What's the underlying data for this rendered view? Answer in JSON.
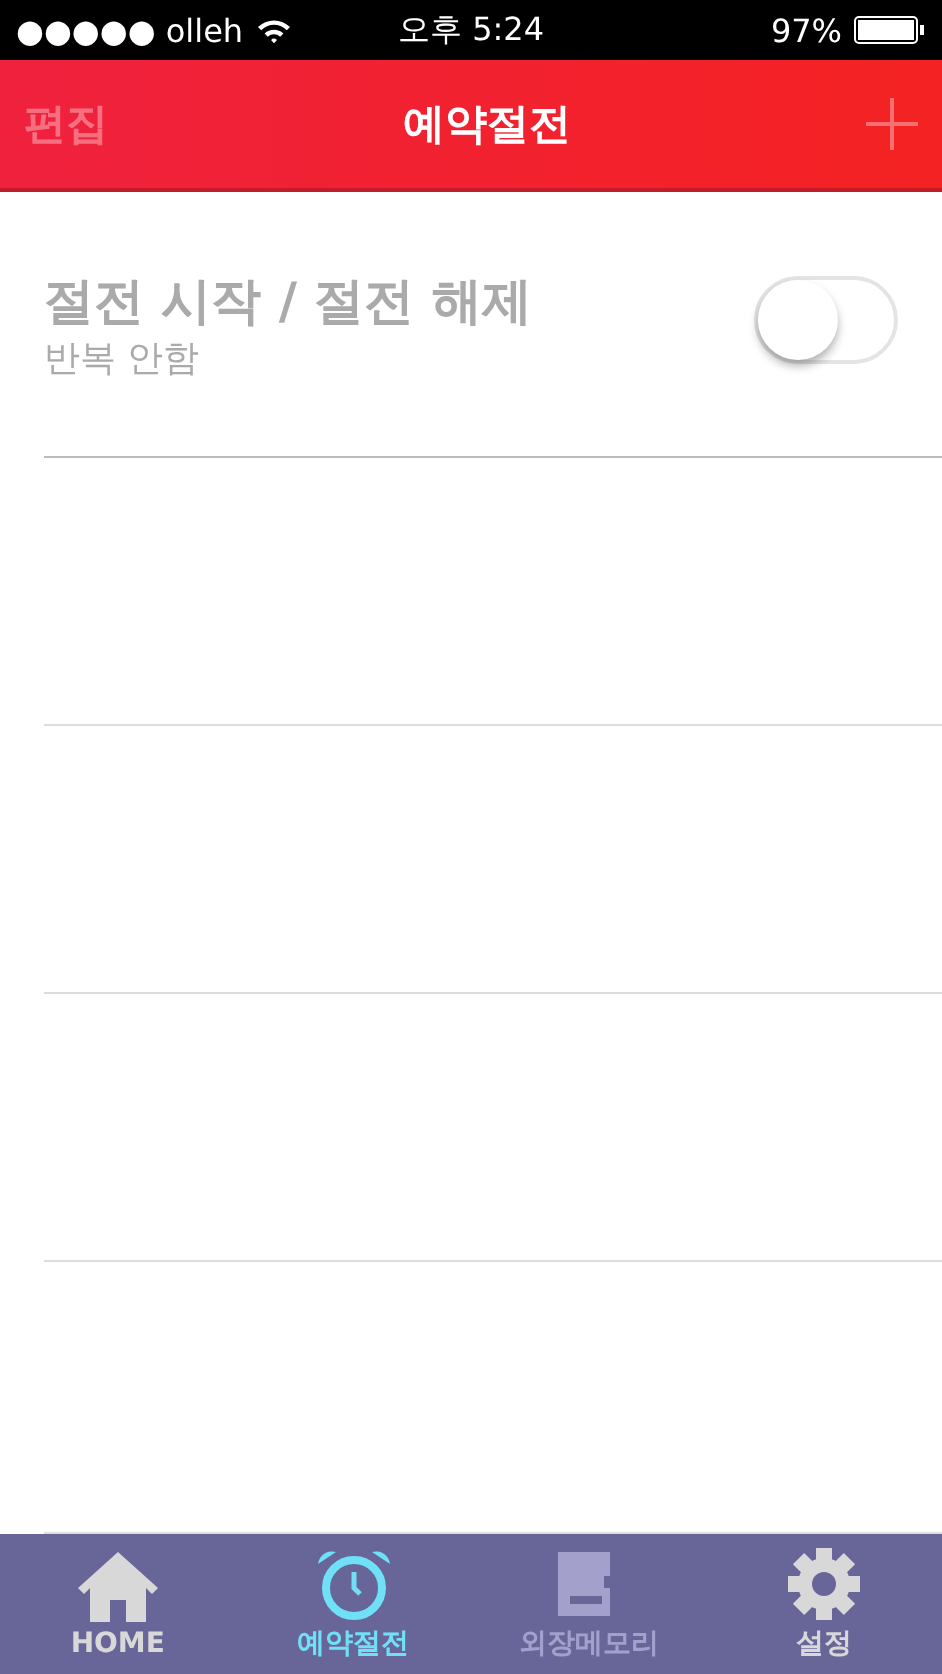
{
  "status_bar": {
    "carrier": "●●●●● olleh",
    "time": "오후 5:24",
    "battery": "97%"
  },
  "nav": {
    "edit": {
      "label": "편집",
      "disabled": true
    },
    "title": "예약절전",
    "add": {
      "disabled": true
    }
  },
  "schedules": [
    {
      "title": "절전 시작 / 절전 해제",
      "repeat": "반복 안함",
      "on": false
    }
  ],
  "tabs": [
    {
      "kind": "home",
      "label": "HOME",
      "selected": false,
      "disabled": false
    },
    {
      "kind": "alarm",
      "label": "예약절전",
      "selected": true,
      "disabled": false
    },
    {
      "kind": "memory",
      "label": "외장메모리",
      "selected": false,
      "disabled": true
    },
    {
      "kind": "settings",
      "label": "설정",
      "selected": false,
      "disabled": false
    }
  ]
}
